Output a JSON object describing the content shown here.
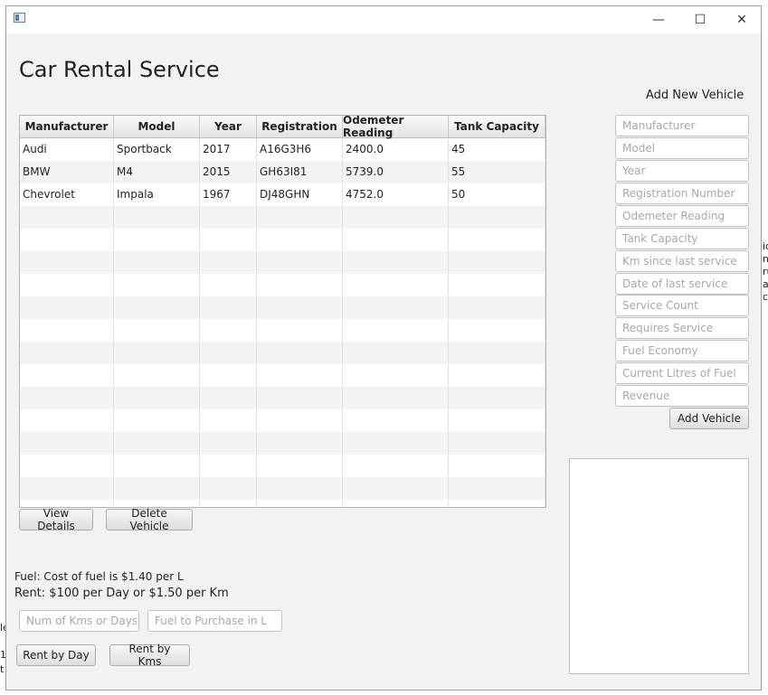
{
  "window": {
    "minimize": "—",
    "maximize": "☐",
    "close": "✕"
  },
  "main": {
    "title": "Car Rental Service"
  },
  "table": {
    "columns": [
      "Manufacturer",
      "Model",
      "Year",
      "Registration",
      "Odemeter Reading",
      "Tank Capacity"
    ],
    "rows": [
      [
        "Audi",
        "Sportback",
        "2017",
        "A16G3H6",
        "2400.0",
        "45"
      ],
      [
        "BMW",
        "M4",
        "2015",
        "GH63I81",
        "5739.0",
        "55"
      ],
      [
        "Chevrolet",
        "Impala",
        "1967",
        "DJ48GHN",
        "4752.0",
        "50"
      ]
    ],
    "empty_rows": 14
  },
  "table_buttons": {
    "view_details": "View Details",
    "delete_vehicle": "Delete Vehicle"
  },
  "info": {
    "fuel": "Fuel: Cost of fuel is $1.40 per L",
    "rent": "Rent: $100 per Day or $1.50 per Km"
  },
  "rent_inputs": {
    "kms_days_placeholder": "Num of Kms or Days",
    "fuel_placeholder": "Fuel to Purchase in L"
  },
  "rent_buttons": {
    "by_day": "Rent by Day",
    "by_kms": "Rent by Kms"
  },
  "add_vehicle": {
    "heading": "Add New Vehicle",
    "fields": [
      "Manufacturer",
      "Model",
      "Year",
      "Registration Number",
      "Odemeter Reading",
      "Tank Capacity",
      "Km since last service",
      "Date of last service",
      "Service Count",
      "Requires Service",
      "Fuel Economy",
      "Current Litres of Fuel",
      "Revenue"
    ],
    "button": "Add Vehicle"
  },
  "background_fragments": [
    "io",
    "ng",
    "ru",
    "a",
    "ct",
    "le",
    "1",
    "t"
  ]
}
